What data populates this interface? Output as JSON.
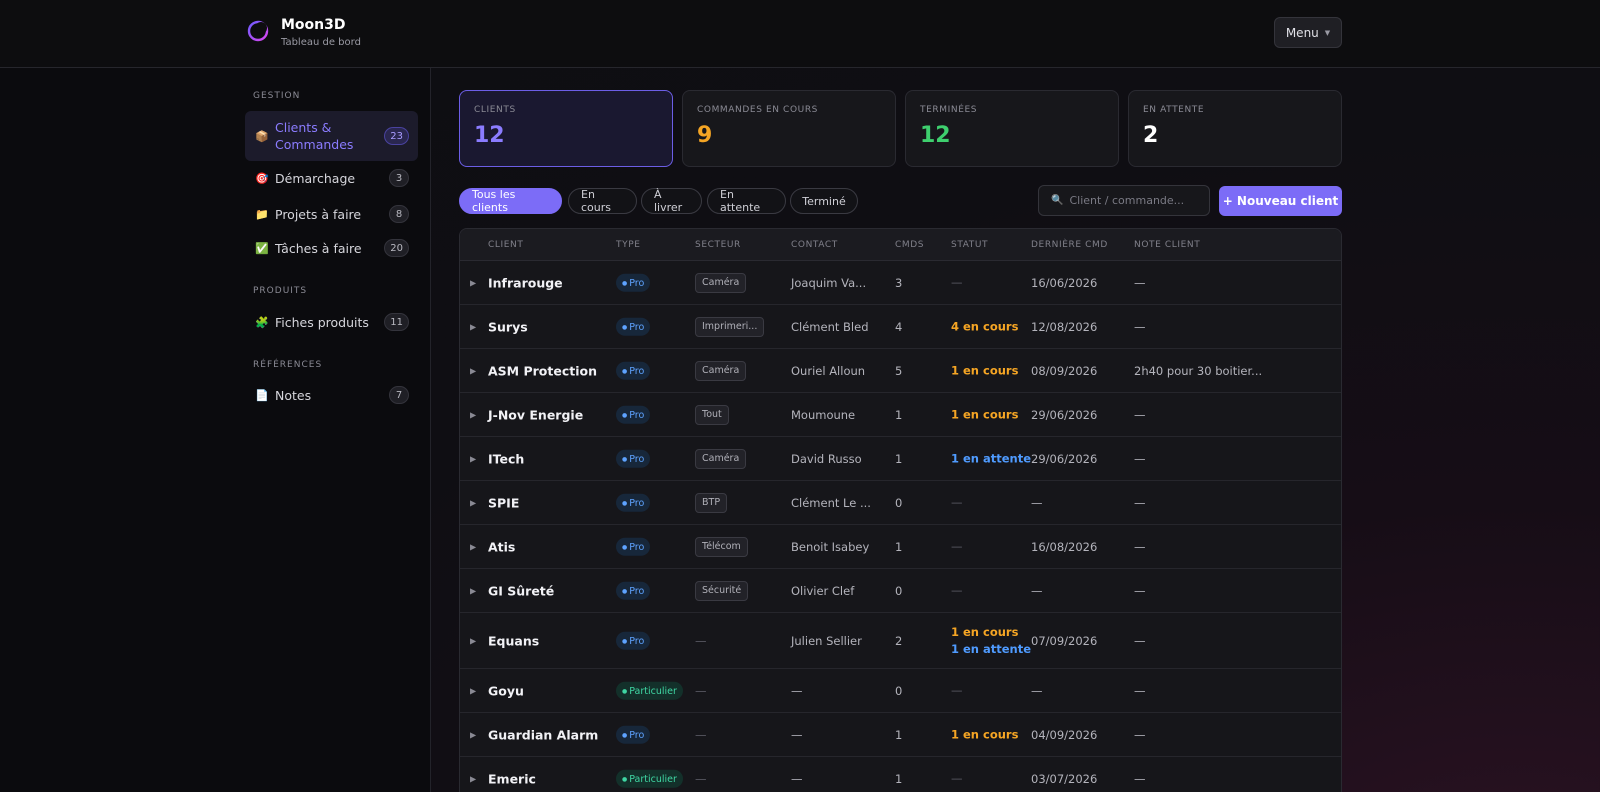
{
  "app": {
    "name": "Moon3D",
    "subtitle": "Tableau de bord",
    "menu_label": "Menu"
  },
  "sidebar": {
    "sections": [
      {
        "title": "GESTION",
        "items": [
          {
            "label": "Clients & Commandes",
            "icon": "package-icon",
            "glyph": "📦",
            "count": "23",
            "active": true
          },
          {
            "label": "Démarchage",
            "icon": "target-icon",
            "glyph": "🎯",
            "count": "3",
            "active": false
          },
          {
            "label": "Projets à faire",
            "icon": "folder-icon",
            "glyph": "📁",
            "count": "8",
            "active": false
          },
          {
            "label": "Tâches à faire",
            "icon": "check-icon",
            "glyph": "✅",
            "count": "20",
            "active": false
          }
        ]
      },
      {
        "title": "PRODUITS",
        "items": [
          {
            "label": "Fiches produits",
            "icon": "puzzle-icon",
            "glyph": "🧩",
            "count": "11",
            "active": false
          }
        ]
      },
      {
        "title": "RÉFÉRENCES",
        "items": [
          {
            "label": "Notes",
            "icon": "note-icon",
            "glyph": "📄",
            "count": "7",
            "active": false
          }
        ]
      }
    ]
  },
  "stats": [
    {
      "label": "CLIENTS",
      "value": "12",
      "color": "#8b7cff",
      "active": true
    },
    {
      "label": "COMMANDES EN COURS",
      "value": "9",
      "color": "#f5a524",
      "active": false
    },
    {
      "label": "TERMINÉES",
      "value": "12",
      "color": "#3ecf6e",
      "active": false
    },
    {
      "label": "EN ATTENTE",
      "value": "2",
      "color": "#ffffff",
      "active": false
    }
  ],
  "filters": [
    {
      "label": "Tous les clients",
      "active": true
    },
    {
      "label": "En cours",
      "active": false
    },
    {
      "label": "À livrer",
      "active": false
    },
    {
      "label": "En attente",
      "active": false
    },
    {
      "label": "Terminé",
      "active": false
    }
  ],
  "search": {
    "placeholder": "Client / commande..."
  },
  "new_client_label": "+ Nouveau client",
  "table": {
    "columns": [
      "CLIENT",
      "TYPE",
      "SECTEUR",
      "CONTACT",
      "CMDS",
      "STATUT",
      "DERNIÈRE CMD",
      "NOTE CLIENT"
    ],
    "rows": [
      {
        "client": "Infrarouge",
        "type": "Pro",
        "sector": "Caméra",
        "contact": "Joaquim Va...",
        "cmds": "3",
        "status": [],
        "last": "16/06/2026",
        "note": "—"
      },
      {
        "client": "Surys",
        "type": "Pro",
        "sector": "Imprimeri...",
        "contact": "Clément Bled",
        "cmds": "4",
        "status": [
          {
            "text": "4 en cours",
            "kind": "orange"
          }
        ],
        "last": "12/08/2026",
        "note": "—"
      },
      {
        "client": "ASM Protection",
        "type": "Pro",
        "sector": "Caméra",
        "contact": "Ouriel Alloun",
        "cmds": "5",
        "status": [
          {
            "text": "1 en cours",
            "kind": "orange"
          }
        ],
        "last": "08/09/2026",
        "note": "2h40 pour 30 boitier..."
      },
      {
        "client": "J-Nov Energie",
        "type": "Pro",
        "sector": "Tout",
        "contact": "Moumoune",
        "cmds": "1",
        "status": [
          {
            "text": "1 en cours",
            "kind": "orange"
          }
        ],
        "last": "29/06/2026",
        "note": "—"
      },
      {
        "client": "ITech",
        "type": "Pro",
        "sector": "Caméra",
        "contact": "David Russo",
        "cmds": "1",
        "status": [
          {
            "text": "1 en attente",
            "kind": "blue"
          }
        ],
        "last": "29/06/2026",
        "note": "—"
      },
      {
        "client": "SPIE",
        "type": "Pro",
        "sector": "BTP",
        "contact": "Clément Le ...",
        "cmds": "0",
        "status": [],
        "last": "—",
        "note": "—"
      },
      {
        "client": "Atis",
        "type": "Pro",
        "sector": "Télécom",
        "contact": "Benoit Isabey",
        "cmds": "1",
        "status": [],
        "last": "16/08/2026",
        "note": "—"
      },
      {
        "client": "GI Sûreté",
        "type": "Pro",
        "sector": "Sécurité",
        "contact": "Olivier Clef",
        "cmds": "0",
        "status": [],
        "last": "—",
        "note": "—"
      },
      {
        "client": "Equans",
        "type": "Pro",
        "sector": "",
        "contact": "Julien Sellier",
        "cmds": "2",
        "status": [
          {
            "text": "1 en cours",
            "kind": "orange"
          },
          {
            "text": "1 en attente",
            "kind": "blue"
          }
        ],
        "last": "07/09/2026",
        "note": "—"
      },
      {
        "client": "Goyu",
        "type": "Particulier",
        "sector": "",
        "contact": "—",
        "cmds": "0",
        "status": [],
        "last": "—",
        "note": "—"
      },
      {
        "client": "Guardian Alarm",
        "type": "Pro",
        "sector": "",
        "contact": "—",
        "cmds": "1",
        "status": [
          {
            "text": "1 en cours",
            "kind": "orange"
          }
        ],
        "last": "04/09/2026",
        "note": "—"
      },
      {
        "client": "Emeric",
        "type": "Particulier",
        "sector": "",
        "contact": "—",
        "cmds": "1",
        "status": [],
        "last": "03/07/2026",
        "note": "—"
      }
    ]
  },
  "dash": "—",
  "expand_glyph": "▶",
  "search_glyph": "🔍"
}
